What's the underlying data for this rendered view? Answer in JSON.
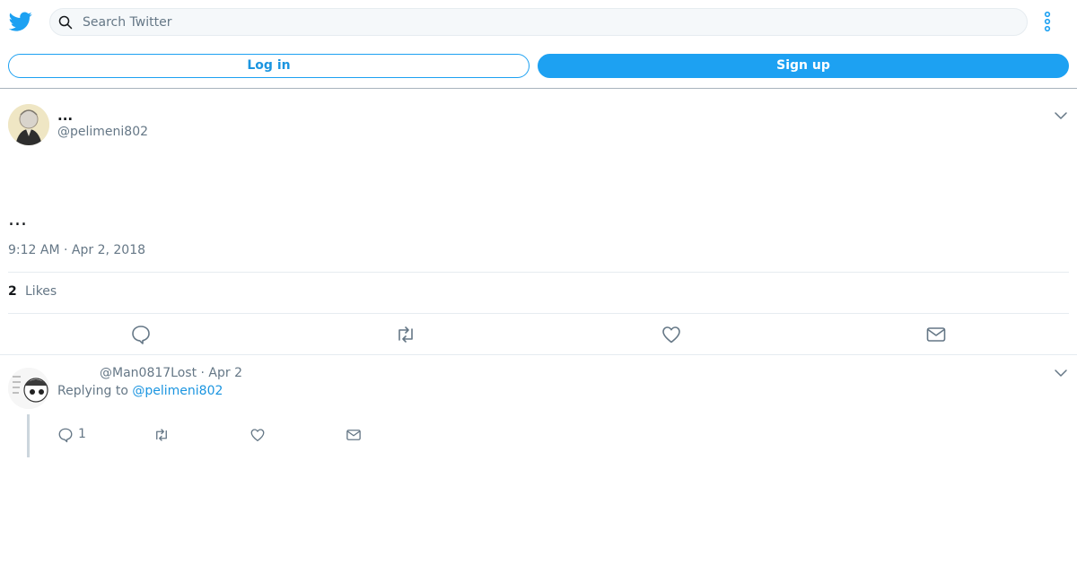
{
  "header": {
    "logo_icon": "twitter-bird-icon",
    "search_placeholder": "Search Twitter",
    "more_icon": "more-vertical-icon"
  },
  "auth": {
    "login_label": "Log in",
    "signup_label": "Sign up"
  },
  "tweet": {
    "display_name": "...",
    "handle": "@pelimeni802",
    "text": "...",
    "timestamp": "9:12 AM · Apr 2, 2018",
    "likes_count": "2",
    "likes_label": "Likes",
    "actions": [
      "reply-icon",
      "retweet-icon",
      "like-icon",
      "share-dm-icon"
    ]
  },
  "reply": {
    "handle_date": "@Man0817Lost · Apr 2",
    "replying_prefix": "Replying to",
    "replying_to": "@pelimeni802",
    "reply_count": "1"
  },
  "colors": {
    "brand": "#1da1f2",
    "link": "#1b95e0",
    "muted": "#657786",
    "border": "#e6ecf0"
  }
}
